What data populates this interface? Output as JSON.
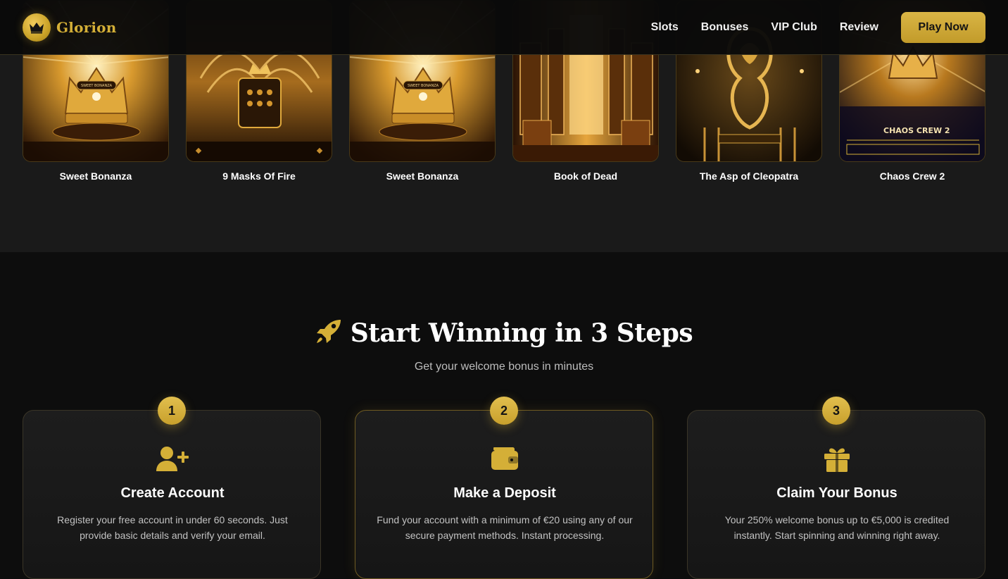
{
  "header": {
    "logo_text": "Glorion",
    "nav": [
      "Slots",
      "Bonuses",
      "VIP Club",
      "Review"
    ],
    "cta_label": "Play Now"
  },
  "games": [
    {
      "title": "Sweet Bonanza",
      "art_label": "SWEET BONANZA"
    },
    {
      "title": "9 Masks Of Fire",
      "art_label": ""
    },
    {
      "title": "Sweet Bonanza",
      "art_label": "SWEET BONANZA"
    },
    {
      "title": "Book of Dead",
      "art_label": ""
    },
    {
      "title": "The Asp of Cleopatra",
      "art_label": ""
    },
    {
      "title": "Chaos Crew 2",
      "art_label": "CHAOS CREW 2"
    }
  ],
  "steps_section": {
    "title": "Start Winning in 3 Steps",
    "subtitle": "Get your welcome bonus in minutes",
    "steps": [
      {
        "number": "1",
        "icon": "user-plus-icon",
        "title": "Create Account",
        "description": "Register your free account in under 60 seconds. Just provide basic details and verify your email."
      },
      {
        "number": "2",
        "icon": "wallet-icon",
        "title": "Make a Deposit",
        "description": "Fund your account with a minimum of €20 using any of our secure payment methods. Instant processing."
      },
      {
        "number": "3",
        "icon": "gift-icon",
        "title": "Claim Your Bonus",
        "description": "Your 250% welcome bonus up to €5,000 is credited instantly. Start spinning and winning right away."
      }
    ]
  },
  "colors": {
    "accent_gold": "#d4af37",
    "page_bg": "#0d0d0d",
    "games_bg": "#1a1a1a"
  }
}
